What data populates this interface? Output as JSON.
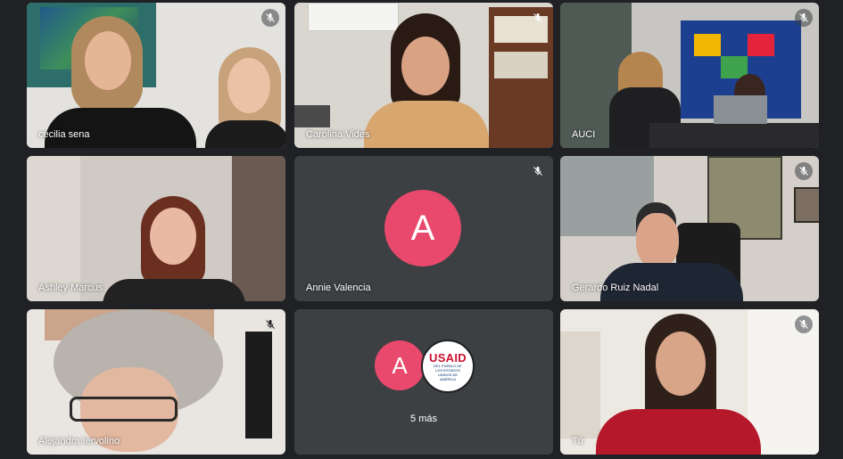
{
  "participants": [
    {
      "name": "cecilia sena",
      "muted": true,
      "type": "video"
    },
    {
      "name": "Carolina Vides",
      "muted": true,
      "type": "video"
    },
    {
      "name": "AUCI",
      "muted": true,
      "type": "video"
    },
    {
      "name": "Ashley Marcus",
      "muted": false,
      "type": "video"
    },
    {
      "name": "Annie Valencia",
      "muted": true,
      "type": "avatar",
      "initial": "A",
      "avatar_color": "#e8496c"
    },
    {
      "name": "Gerardo Ruiz Nadal",
      "muted": true,
      "type": "video"
    },
    {
      "name": "Alejandra Iervolino",
      "muted": true,
      "type": "video"
    },
    {
      "name": "Tú",
      "muted": true,
      "type": "video"
    }
  ],
  "overflow_tile": {
    "initial": "A",
    "avatar_color": "#e8496c",
    "logo_text": "USAID",
    "logo_subtext": "DEL PUEBLO DE LOS ESTADOS UNIDOS DE AMÉRICA",
    "label": "5 más"
  },
  "icons": {
    "mute": "mic-off-icon"
  },
  "colors": {
    "background": "#202124",
    "tile": "#3c4043",
    "avatar": "#e8496c",
    "usaid_red": "#c8102e",
    "usaid_blue": "#002f6c"
  }
}
